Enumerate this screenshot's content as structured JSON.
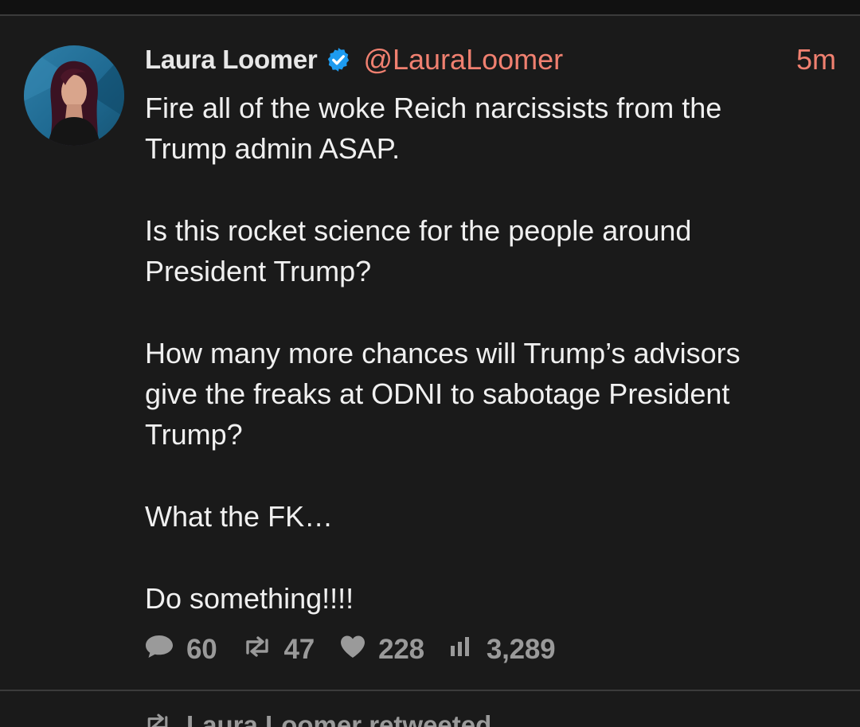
{
  "tweet": {
    "display_name": "Laura Loomer",
    "verified": true,
    "handle": "@LauraLoomer",
    "timestamp": "5m",
    "paragraphs": [
      [
        "Fire all of the woke Reich narcissists from the",
        "Trump admin ASAP."
      ],
      [
        "Is this rocket science for the people around",
        "President Trump?"
      ],
      [
        "How many more chances will Trump’s advisors",
        "give the freaks at ODNI to sabotage President",
        "Trump?"
      ],
      [
        "What the FK…"
      ],
      [
        "Do something!!!!"
      ]
    ],
    "actions": {
      "replies": "60",
      "retweets": "47",
      "likes": "228",
      "views": "3,289"
    },
    "icons": {
      "reply": "comment-bubble-icon",
      "retweet": "retweet-icon",
      "like": "heart-icon",
      "views": "bar-chart-icon",
      "verified": "verified-badge-icon"
    }
  },
  "next_item": {
    "retweeted_label": "Laura Loomer retweeted"
  },
  "colors": {
    "background": "#1a1a1a",
    "accent": "#f08070",
    "verified": "#1d9bf0",
    "text": "#f0f0f0",
    "muted": "#9a9a9a"
  }
}
